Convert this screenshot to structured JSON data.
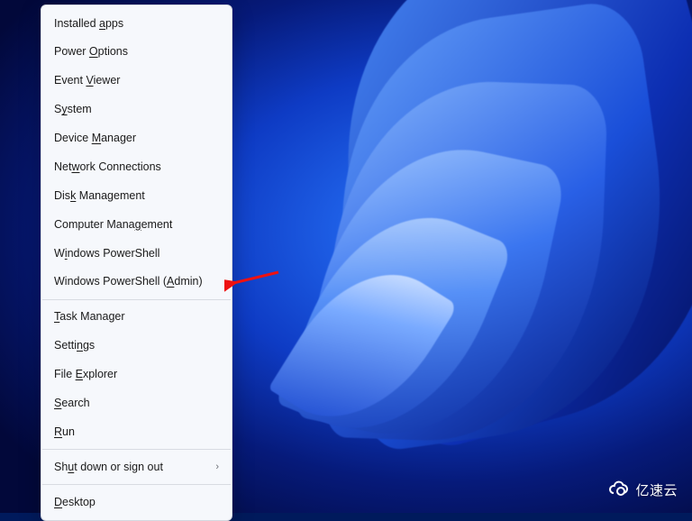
{
  "menu": {
    "items": [
      {
        "pre": "Installed ",
        "u": "a",
        "post": "pps",
        "separator_after": false,
        "submenu": false
      },
      {
        "pre": "Power ",
        "u": "O",
        "post": "ptions",
        "separator_after": false,
        "submenu": false
      },
      {
        "pre": "Event ",
        "u": "V",
        "post": "iewer",
        "separator_after": false,
        "submenu": false
      },
      {
        "pre": "S",
        "u": "y",
        "post": "stem",
        "separator_after": false,
        "submenu": false
      },
      {
        "pre": "Device ",
        "u": "M",
        "post": "anager",
        "separator_after": false,
        "submenu": false
      },
      {
        "pre": "Net",
        "u": "w",
        "post": "ork Connections",
        "separator_after": false,
        "submenu": false
      },
      {
        "pre": "Dis",
        "u": "k",
        "post": " Management",
        "separator_after": false,
        "submenu": false
      },
      {
        "pre": "Computer Mana",
        "u": "g",
        "post": "ement",
        "separator_after": false,
        "submenu": false
      },
      {
        "pre": "W",
        "u": "i",
        "post": "ndows PowerShell",
        "separator_after": false,
        "submenu": false
      },
      {
        "pre": "Windows PowerShell (",
        "u": "A",
        "post": "dmin)",
        "separator_after": true,
        "submenu": false,
        "highlighted": true
      },
      {
        "pre": "",
        "u": "T",
        "post": "ask Manager",
        "separator_after": false,
        "submenu": false
      },
      {
        "pre": "Setti",
        "u": "n",
        "post": "gs",
        "separator_after": false,
        "submenu": false
      },
      {
        "pre": "File ",
        "u": "E",
        "post": "xplorer",
        "separator_after": false,
        "submenu": false
      },
      {
        "pre": "",
        "u": "S",
        "post": "earch",
        "separator_after": false,
        "submenu": false
      },
      {
        "pre": "",
        "u": "R",
        "post": "un",
        "separator_after": true,
        "submenu": false
      },
      {
        "pre": "Sh",
        "u": "u",
        "post": "t down or sign out",
        "separator_after": true,
        "submenu": true
      },
      {
        "pre": "",
        "u": "D",
        "post": "esktop",
        "separator_after": false,
        "submenu": false
      }
    ]
  },
  "arrow": {
    "color": "#e11"
  },
  "watermark": {
    "text": "亿速云"
  }
}
